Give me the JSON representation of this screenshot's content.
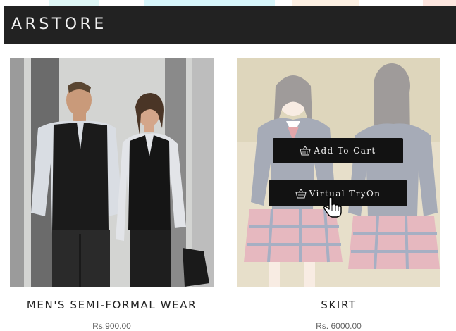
{
  "header": {
    "brand": "ARSTORE"
  },
  "products": [
    {
      "name": "MEN'S SEMI-FORMAL WEAR",
      "price": "Rs.900.00"
    },
    {
      "name": "SKIRT",
      "price": "Rs. 6000.00",
      "actions": {
        "add_to_cart": "Add To Cart",
        "virtual_tryon": "Virtual TryOn"
      }
    }
  ],
  "icons": {
    "cart": "basket-icon",
    "cursor": "hand-pointer-icon"
  },
  "colors": {
    "header_bg": "#222222",
    "button_bg": "#121212",
    "brand_text": "#f2f2f2"
  }
}
